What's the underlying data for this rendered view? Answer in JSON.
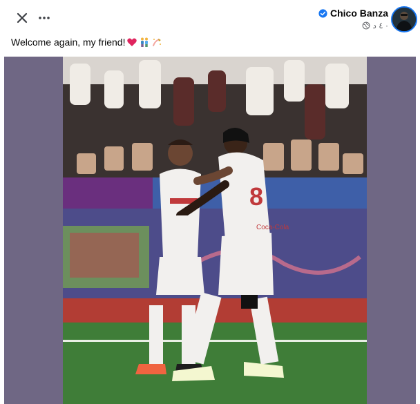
{
  "header": {
    "close_icon": "close-icon",
    "more_icon": "more-options-icon",
    "author_name": "Chico Banza",
    "verified_icon": "verified-badge-icon",
    "time_text": "٤ د ·",
    "audience_icon": "public-globe-icon"
  },
  "post": {
    "caption": "Welcome again, my friend!",
    "caption_emojis": [
      "red-heart",
      "two-men-holding-hands",
      "wave-hand-sparkles"
    ]
  },
  "photo": {
    "description_icon": "post-photo",
    "jersey_text": "8",
    "sponsor_text": "Coca-Cola"
  },
  "colors": {
    "accent": "#1877f2",
    "media_bg": "#6f6784",
    "pitch": "#3f7d38",
    "track": "#b23d34"
  }
}
